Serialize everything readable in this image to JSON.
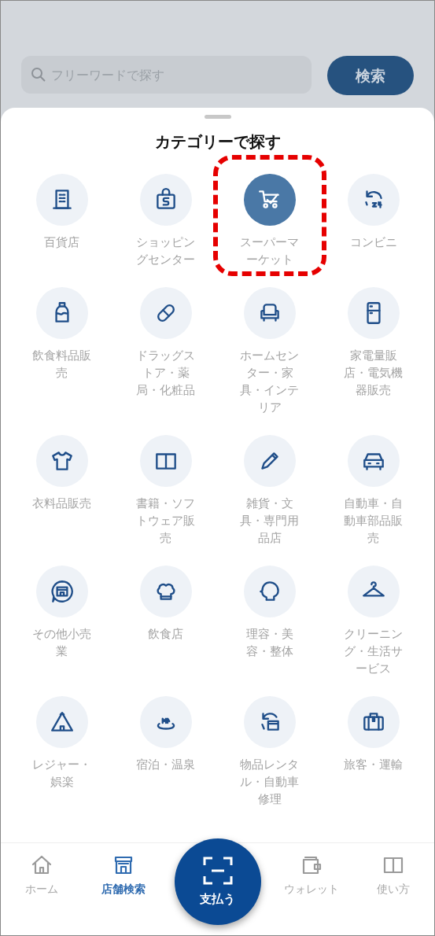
{
  "search": {
    "placeholder": "フリーワードで探す",
    "button": "検索"
  },
  "sheet": {
    "title": "カテゴリーで探す"
  },
  "categories": [
    {
      "label": "百貨店",
      "selected": false
    },
    {
      "label": "ショッピングセンター",
      "selected": false
    },
    {
      "label": "スーパーマーケット",
      "selected": true
    },
    {
      "label": "コンビニ",
      "selected": false
    },
    {
      "label": "飲食料品販売",
      "selected": false
    },
    {
      "label": "ドラッグストア・薬局・化粧品",
      "selected": false
    },
    {
      "label": "ホームセンター・家具・インテリア",
      "selected": false
    },
    {
      "label": "家電量販店・電気機器販売",
      "selected": false
    },
    {
      "label": "衣料品販売",
      "selected": false
    },
    {
      "label": "書籍・ソフトウェア販売",
      "selected": false
    },
    {
      "label": "雑貨・文具・専門用品店",
      "selected": false
    },
    {
      "label": "自動車・自動車部品販売",
      "selected": false
    },
    {
      "label": "その他小売業",
      "selected": false
    },
    {
      "label": "飲食店",
      "selected": false
    },
    {
      "label": "理容・美容・整体",
      "selected": false
    },
    {
      "label": "クリーニング・生活サービス",
      "selected": false
    },
    {
      "label": "レジャー・娯楽",
      "selected": false
    },
    {
      "label": "宿泊・温泉",
      "selected": false
    },
    {
      "label": "物品レンタル・自動車修理",
      "selected": false
    },
    {
      "label": "旅客・運輸",
      "selected": false
    }
  ],
  "bottom_nav": {
    "items": [
      {
        "label": "ホーム",
        "selected": false
      },
      {
        "label": "店舗検索",
        "selected": true
      },
      {
        "label": "ウォレット",
        "selected": false
      },
      {
        "label": "使い方",
        "selected": false
      }
    ],
    "pay_button": "支払う"
  }
}
